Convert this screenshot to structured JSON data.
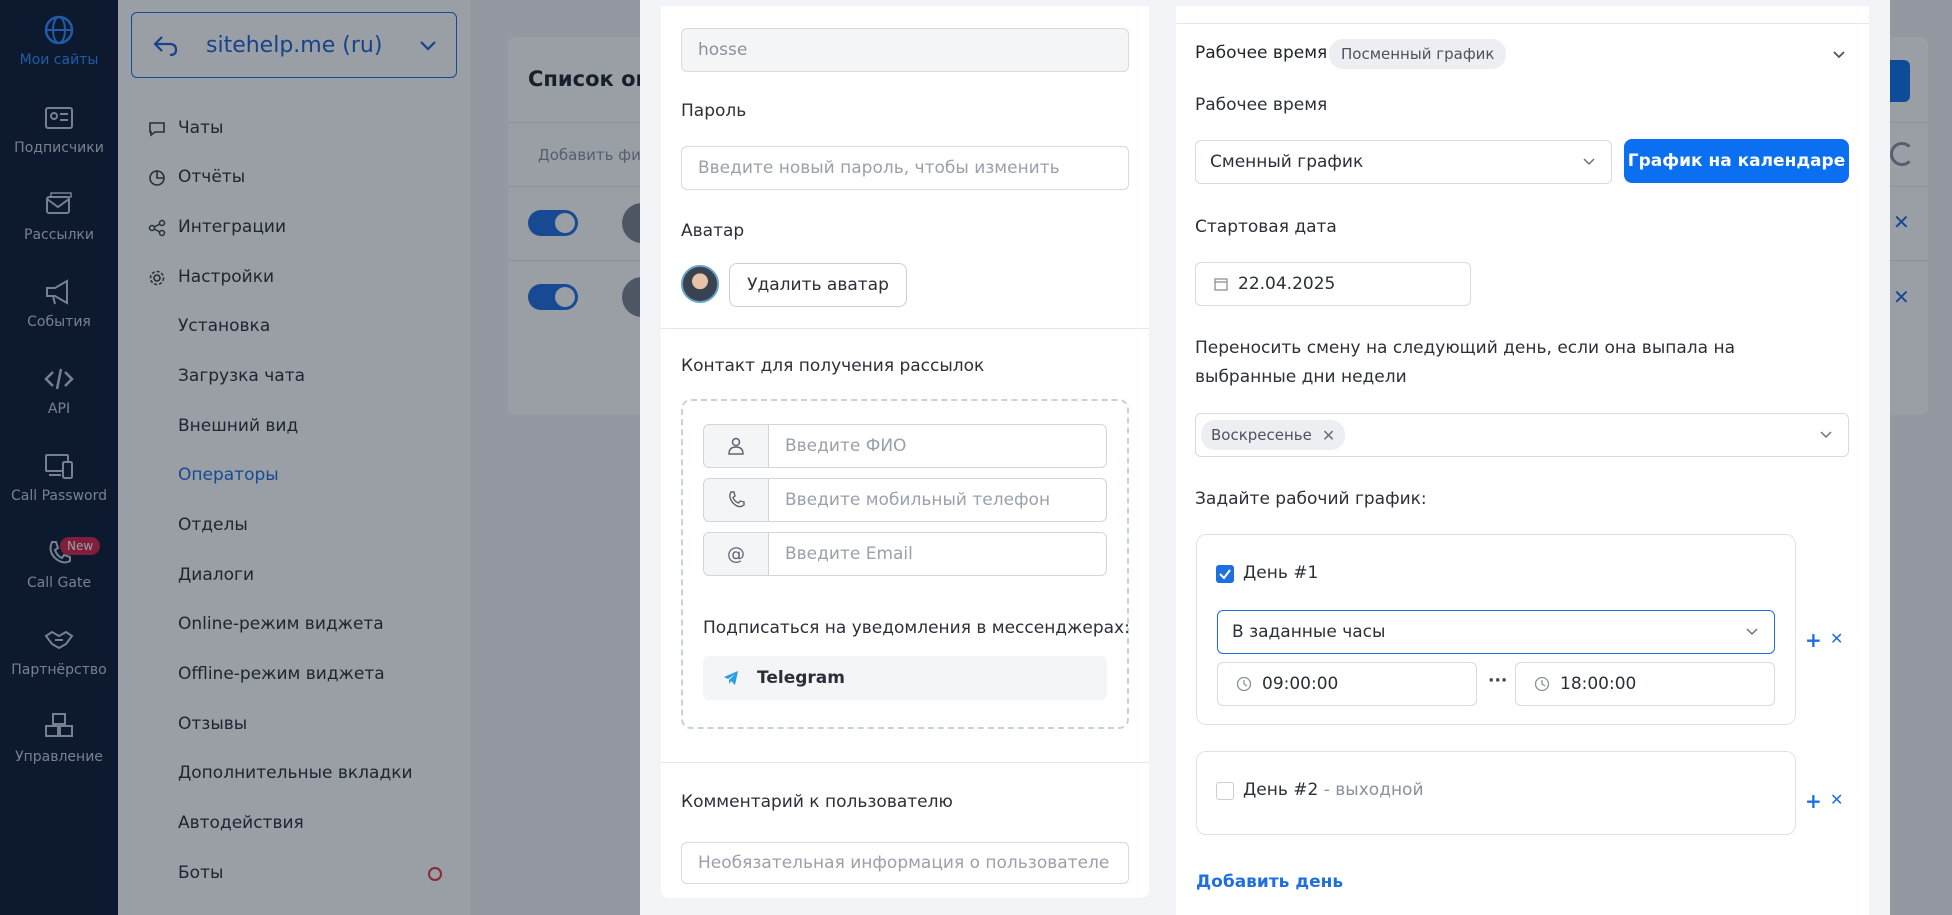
{
  "rail": {
    "items": [
      {
        "label": "Мои сайты",
        "icon": "globe-icon",
        "active": true
      },
      {
        "label": "Подписчики",
        "icon": "id-card-icon"
      },
      {
        "label": "Рассылки",
        "icon": "mail-stack-icon"
      },
      {
        "label": "События",
        "icon": "megaphone-icon"
      },
      {
        "label": "API",
        "icon": "code-icon"
      },
      {
        "label": "Call Password",
        "icon": "devices-icon"
      },
      {
        "label": "Call Gate",
        "icon": "phone-icon",
        "badge": "New"
      },
      {
        "label": "Партнёрство",
        "icon": "handshake-icon"
      },
      {
        "label": "Управление",
        "icon": "boxes-icon"
      }
    ]
  },
  "sidebar": {
    "site": "sitehelp.me (ru)",
    "top_items": [
      {
        "label": "Чаты",
        "icon": "chat-icon"
      },
      {
        "label": "Отчёты",
        "icon": "pie-icon"
      },
      {
        "label": "Интеграции",
        "icon": "nodes-icon"
      },
      {
        "label": "Настройки",
        "icon": "gear-icon"
      }
    ],
    "sub_items": [
      "Установка",
      "Загрузка чата",
      "Внешний вид",
      "Операторы",
      "Отделы",
      "Диалоги",
      "Online-режим виджета",
      "Offline-режим виджета",
      "Отзывы",
      "Дополнительные вкладки",
      "Автодействия",
      "Боты"
    ],
    "active_sub": "Операторы"
  },
  "background": {
    "title": "Список опе",
    "filter_placeholder": "Добавить фил"
  },
  "form": {
    "login_value": "hosse",
    "password_label": "Пароль",
    "password_placeholder": "Введите новый пароль, чтобы изменить",
    "avatar_label": "Аватар",
    "delete_avatar": "Удалить аватар",
    "contact_label": "Контакт для получения рассылок",
    "fio_placeholder": "Введите ФИО",
    "phone_placeholder": "Введите мобильный телефон",
    "email_placeholder": "Введите Email",
    "email_addon": "@",
    "subscribe_label": "Подписаться на уведомления в мессенджерах:",
    "telegram": "Telegram",
    "comment_label": "Комментарий к пользователю",
    "comment_placeholder": "Необязательная информация о пользователе"
  },
  "schedule": {
    "section_title": "Рабочее время",
    "section_pill": "Посменный график",
    "worktime_label": "Рабочее время",
    "worktime_value": "Сменный график",
    "calendar_button": "График на календаре",
    "start_date_label": "Стартовая дата",
    "start_date": "22.04.2025",
    "carry_label": "Переносить смену на следующий день, если она выпала на выбранные дни недели",
    "carry_tag": "Воскресенье",
    "set_label": "Задайте рабочий график:",
    "days": [
      {
        "title": "День #1",
        "checked": true,
        "mode": "В заданные часы",
        "from": "09:00:00",
        "to": "18:00:00"
      },
      {
        "title": "День #2",
        "checked": false,
        "suffix": "- выходной"
      }
    ],
    "time_separator": "···",
    "add_day": "Добавить день",
    "add_symbol": "+",
    "remove_symbol": "✕"
  },
  "colors": {
    "accent": "#0a6ff0",
    "rail": "#0c1a33",
    "badge": "#d0254a"
  }
}
